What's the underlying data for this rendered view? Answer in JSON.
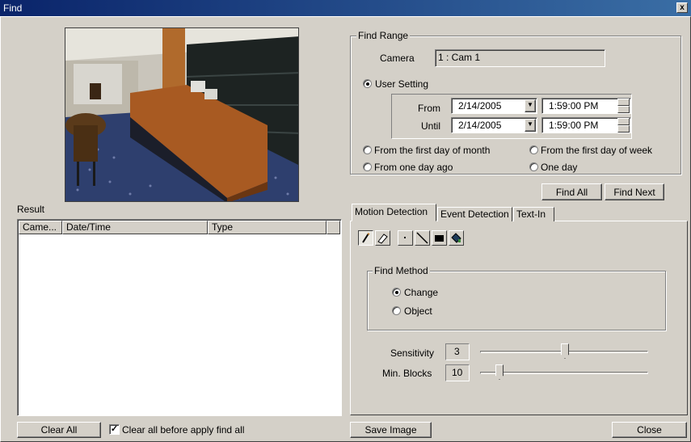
{
  "window": {
    "title": "Find",
    "close_glyph": "x"
  },
  "find_range": {
    "legend": "Find Range",
    "camera_label": "Camera",
    "camera_value": "1 : Cam 1",
    "user_setting_label": "User Setting",
    "user_setting_selected": true,
    "from_label": "From",
    "from_date": "2/14/2005",
    "from_time": "1:59:00 PM",
    "until_label": "Until",
    "until_date": "2/14/2005",
    "until_time": "1:59:00 PM",
    "presets": [
      {
        "label": "From the first day of month",
        "selected": false
      },
      {
        "label": "From the first day of week",
        "selected": false
      },
      {
        "label": "From one day ago",
        "selected": false
      },
      {
        "label": "One day",
        "selected": false
      }
    ]
  },
  "actions": {
    "find_all": "Find All",
    "find_next": "Find Next"
  },
  "result": {
    "label": "Result",
    "columns": [
      "Came...",
      "Date/Time",
      "Type"
    ],
    "rows": []
  },
  "bottom": {
    "clear_all": "Clear All",
    "clear_before_label": "Clear all before apply find all",
    "clear_before_checked": true,
    "save_image": "Save Image",
    "close": "Close"
  },
  "tabs": [
    {
      "label": "Motion Detection",
      "active": true
    },
    {
      "label": "Event Detection",
      "active": false
    },
    {
      "label": "Text-In",
      "active": false
    }
  ],
  "toolbar": {
    "tools": [
      "pencil-icon",
      "eraser-icon",
      "dot-icon",
      "line-icon",
      "rectangle-fill-icon",
      "fill-bucket-icon"
    ],
    "pressed": "pencil-icon"
  },
  "find_method": {
    "legend": "Find Method",
    "options": [
      {
        "label": "Change",
        "selected": true
      },
      {
        "label": "Object",
        "selected": false
      }
    ]
  },
  "sensitivity": {
    "label": "Sensitivity",
    "value": "3",
    "level": 0.5
  },
  "min_blocks": {
    "label": "Min. Blocks",
    "value": "10",
    "level": 0.1
  },
  "colors": {
    "title_start": "#0a246a",
    "title_end": "#3a6ea5",
    "face": "#d4d0c8"
  }
}
